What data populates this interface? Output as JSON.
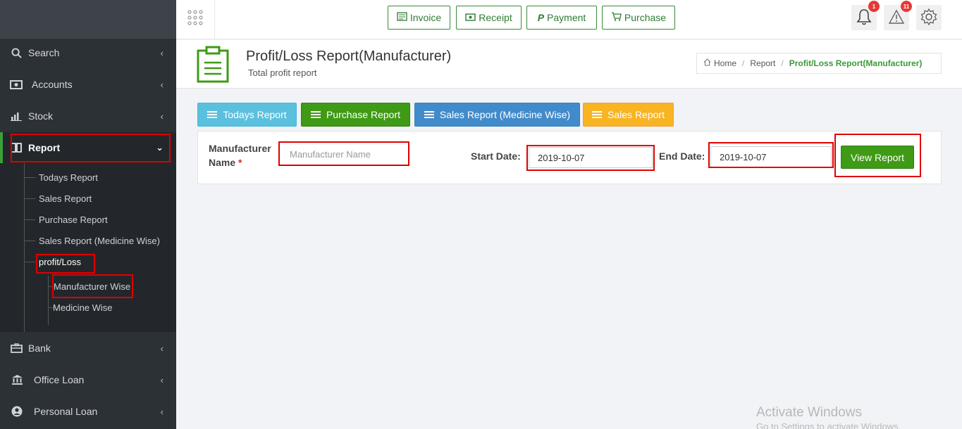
{
  "sidebar": {
    "items": [
      {
        "label": "Search",
        "icon": "search-icon"
      },
      {
        "label": "Accounts",
        "icon": "money-icon"
      },
      {
        "label": "Stock",
        "icon": "bar-chart-icon"
      },
      {
        "label": "Report",
        "icon": "book-icon"
      },
      {
        "label": "Bank",
        "icon": "briefcase-icon"
      },
      {
        "label": "Office Loan",
        "icon": "bank-icon"
      },
      {
        "label": "Personal Loan",
        "icon": "user-icon"
      }
    ],
    "report_sub": [
      "Todays Report",
      "Sales Report",
      "Purchase Report",
      "Sales Report (Medicine Wise)",
      "profit/Loss"
    ],
    "profit_sub": [
      "Manufacturer Wise",
      "Medicine Wise"
    ]
  },
  "topbar": {
    "buttons": [
      "Invoice",
      "Receipt",
      "Payment",
      "Purchase"
    ],
    "notif_count": "1",
    "alert_count": "11"
  },
  "header": {
    "title": "Profit/Loss Report(Manufacturer)",
    "subtitle": "Total profit report",
    "breadcrumb": [
      "Home",
      "Report",
      "Profit/Loss Report(Manufacturer)"
    ]
  },
  "report_buttons": [
    "Todays Report",
    "Purchase Report",
    "Sales Report (Medicine Wise)",
    "Sales Report"
  ],
  "form": {
    "manufacturer_label_1": "Manufacturer",
    "manufacturer_label_2": "Name",
    "required_mark": "*",
    "manufacturer_placeholder": "Manufacturer  Name",
    "start_label": "Start Date:",
    "start_value": "2019-10-07",
    "end_label": "End Date:",
    "end_value": "2019-10-07",
    "submit_label": "View Report"
  },
  "watermark": {
    "line1": "Activate Windows",
    "line2": "Go to Settings to activate Windows."
  },
  "colors": {
    "sidebar_bg": "#2c3136",
    "accent_green": "#3f9a16",
    "info_blue": "#5bc0de",
    "primary_blue": "#428bca",
    "warning_yellow": "#f8b423",
    "highlight_red": "#e00000"
  }
}
